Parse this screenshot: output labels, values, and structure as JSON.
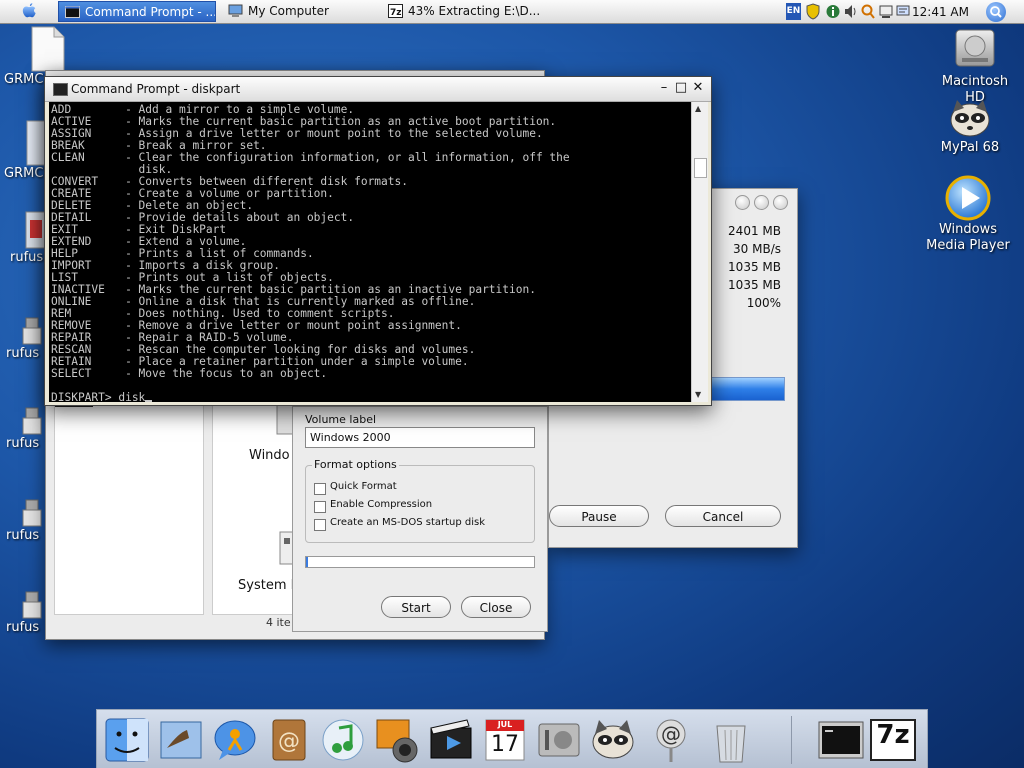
{
  "menubar": {
    "tasks": [
      {
        "label": "Command Prompt - ...",
        "active": true
      },
      {
        "label": "My Computer",
        "active": false
      },
      {
        "label": "43% Extracting E:\\D...",
        "active": false
      }
    ],
    "tray": {
      "lang": "EN"
    },
    "clock": "12:41 AM"
  },
  "desktop": {
    "left_icons": [
      "GRMC",
      "GRMC",
      "rufus",
      "rufus",
      "rufus",
      "rufus",
      "rufus"
    ],
    "right_icons": [
      {
        "label": "Macintosh HD",
        "icon": "hard-drive-icon"
      },
      {
        "label": "MyPal 68",
        "icon": "raccoon-icon"
      },
      {
        "label": "Windows Media Player",
        "icon": "media-player-icon"
      }
    ]
  },
  "cmd": {
    "title": "Command Prompt - diskpart",
    "lines": [
      "ADD        - Add a mirror to a simple volume.",
      "ACTIVE     - Marks the current basic partition as an active boot partition.",
      "ASSIGN     - Assign a drive letter or mount point to the selected volume.",
      "BREAK      - Break a mirror set.",
      "CLEAN      - Clear the configuration information, or all information, off the",
      "             disk.",
      "CONVERT    - Converts between different disk formats.",
      "CREATE     - Create a volume or partition.",
      "DELETE     - Delete an object.",
      "DETAIL     - Provide details about an object.",
      "EXIT       - Exit DiskPart",
      "EXTEND     - Extend a volume.",
      "HELP       - Prints a list of commands.",
      "IMPORT     - Imports a disk group.",
      "LIST       - Prints out a list of objects.",
      "INACTIVE   - Marks the current basic partition as an inactive partition.",
      "ONLINE     - Online a disk that is currently marked as offline.",
      "REM        - Does nothing. Used to comment scripts.",
      "REMOVE     - Remove a drive letter or mount point assignment.",
      "REPAIR     - Repair a RAID-5 volume.",
      "RESCAN     - Rescan the computer looking for disks and volumes.",
      "RETAIN     - Place a retainer partition under a simple volume.",
      "SELECT     - Move the focus to an object.",
      ""
    ],
    "prompt": "DISKPART> disk"
  },
  "extract": {
    "values": [
      "2401 MB",
      "30 MB/s",
      "1035 MB",
      "1035 MB",
      "100%"
    ],
    "progress": 0.43,
    "pause_label": "Pause",
    "cancel_label": "Cancel"
  },
  "explorer": {
    "item_label_1": "Windo",
    "item_label_2": "System F",
    "status": "4 ite"
  },
  "rufus": {
    "volume_label_title": "Volume label",
    "volume_label_value": "Windows 2000",
    "format_options_title": "Format options",
    "options": [
      {
        "label": "Quick Format",
        "checked": false
      },
      {
        "label": "Enable Compression",
        "checked": false
      },
      {
        "label": "Create an MS-DOS startup disk",
        "checked": false
      }
    ],
    "start_label": "Start",
    "close_label": "Close"
  },
  "dock": {
    "items": [
      "finder-icon",
      "mail-icon",
      "ichat-icon",
      "address-book-icon",
      "itunes-icon",
      "iphoto-icon",
      "imovie-icon",
      "ical-icon",
      "system-preferences-icon",
      "mypal-icon",
      "at-sign-icon",
      "trash-icon",
      "terminal-icon",
      "7zip-icon"
    ],
    "ical_month": "JUL",
    "ical_day": "17",
    "sevenzip_label": "7z"
  }
}
